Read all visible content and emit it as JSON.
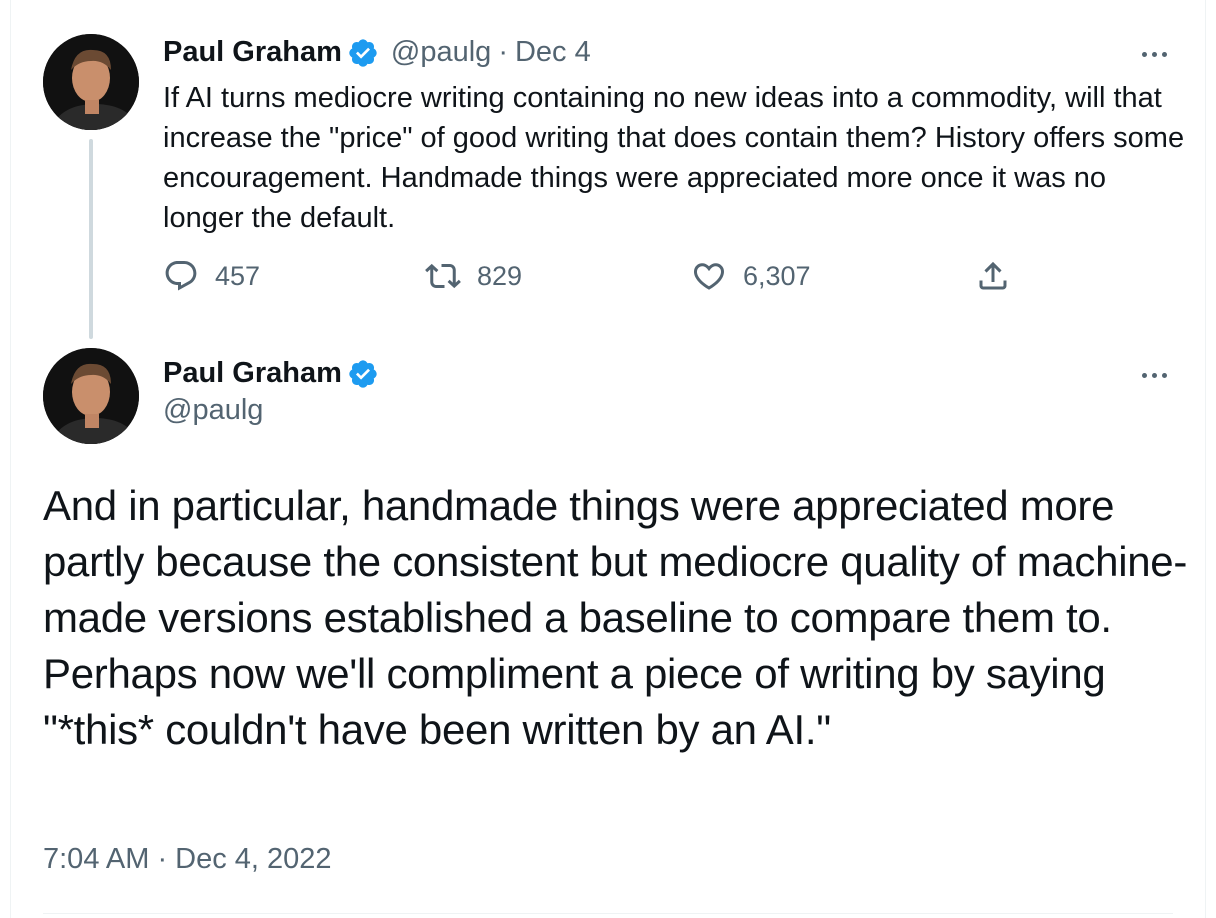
{
  "tweet1": {
    "author_name": "Paul Graham",
    "handle": "@paulg",
    "separator": "·",
    "date": "Dec 4",
    "text": "If AI turns mediocre writing containing no new ideas into a commodity, will that increase the \"price\" of good writing that does contain them? History offers some encouragement. Handmade things were appreciated more once it was no longer the default.",
    "replies": "457",
    "retweets": "829",
    "likes": "6,307"
  },
  "tweet2": {
    "author_name": "Paul Graham",
    "handle": "@paulg",
    "text": "And in particular, handmade things were appreciated more partly because the consistent but mediocre quality of machine-made versions established a baseline to compare them to. Perhaps now we'll compliment a piece of writing by saying \"*this* couldn't have been written by an AI.\"",
    "timestamp": "7:04 AM · Dec 4, 2022"
  },
  "icons": {
    "verified": "verified-badge-icon",
    "reply": "reply-icon",
    "retweet": "retweet-icon",
    "like": "heart-icon",
    "share": "share-icon",
    "more": "more-icon"
  },
  "colors": {
    "verified_blue": "#1d9bf0",
    "secondary_text": "#536471",
    "primary_text": "#0f1419",
    "thread_line": "#cfd9de"
  }
}
